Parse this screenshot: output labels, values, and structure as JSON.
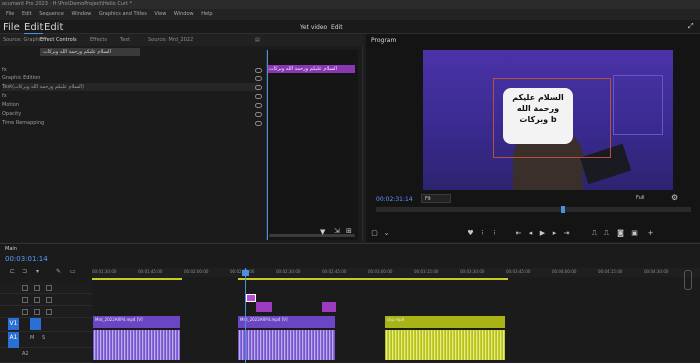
{
  "titlebar": {
    "text": "ocument Pro 2023 · H:\\Pro\\DemoProject\\Hello Curt *"
  },
  "menubar": {
    "items": [
      "File",
      "Edit",
      "Sequence",
      "Window",
      "Graphics and Titles",
      "View",
      "Window",
      "Help"
    ]
  },
  "workspace": {
    "items": [
      "File",
      "Edit",
      "Edit",
      "Yet video",
      "Edit"
    ]
  },
  "effect_controls": {
    "tabs": [
      "Source: Graphic",
      "Effect Controls",
      "Effects",
      "Text",
      "Source: Mrd_2022"
    ],
    "clip_chip": "السلام عليكم ورحمة الله وبركات",
    "rows": [
      "fx",
      "Graphic Edition",
      "Text(السلام عليكم ورحمة الله وبركات)",
      "fx",
      "Motion",
      "Opacity",
      "Time Remapping"
    ],
    "mini_clip": "السلام عليكم ورحمة الله وبركات"
  },
  "program": {
    "title": "Program",
    "caption": "السلام عليكم ورحمة الله وبركات b",
    "timecode": "00:02:31:14",
    "fit": "Fit",
    "quality": "Full"
  },
  "timeline": {
    "tab": "Main",
    "timecode": "00:03:01:14",
    "ruler": [
      "00:01:30:00",
      "00:01:45:00",
      "00:02:00:00",
      "00:02:15:00",
      "00:02:30:00",
      "00:02:45:00",
      "00:03:00:00",
      "00:03:15:00",
      "00:03:30:00",
      "00:03:45:00",
      "00:04:00:00",
      "00:04:15:00",
      "00:04:30:00"
    ],
    "track_labels": {
      "v1": "V1",
      "a1": "A1",
      "a2": "A2"
    },
    "clips": [
      {
        "label": "Mrd_2022ARP4.mp4 [V]",
        "color": "#6b45c4"
      },
      {
        "label": "Mrd_2022ARP4.mp4 [V]",
        "color": "#6b45c4"
      },
      {
        "label": "clip.mp4",
        "color": "#a8b416"
      }
    ]
  },
  "colors": {
    "accent": "#4a90e2",
    "clip_purple": "#6b45c4",
    "clip_yellow": "#a8b416",
    "title_clip": "#9b3bc0"
  }
}
